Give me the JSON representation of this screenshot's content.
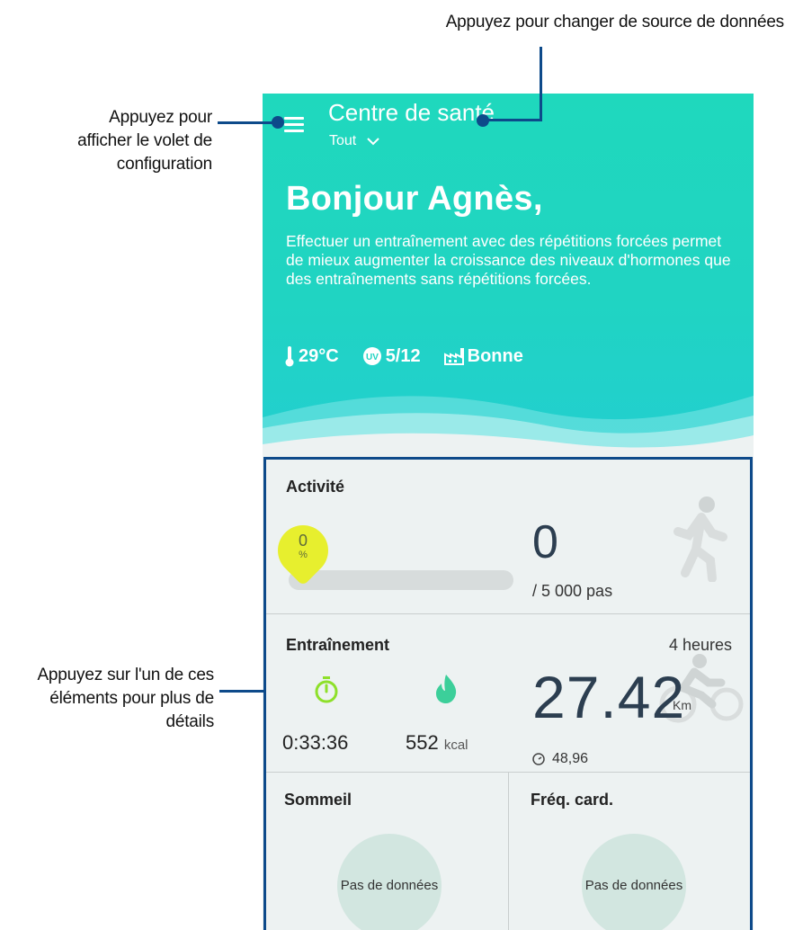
{
  "callouts": {
    "source": "Appuyez pour changer de source de données",
    "menu": [
      "Appuyez pour",
      "afficher le volet de",
      "configuration"
    ],
    "cards": [
      "Appuyez sur l'un de ces",
      "éléments pour plus de",
      "détails"
    ]
  },
  "header": {
    "app_title": "Centre de santé",
    "source": "Tout",
    "greeting": "Bonjour Agnès,",
    "tip": "Effectuer un entraînement avec des répétitions forcées permet de mieux augmenter la croissance des niveaux d'hormones que des entraînements sans répétitions forcées.",
    "weather": {
      "temperature": "29°C",
      "uv": "5/12",
      "air_quality": "Bonne"
    }
  },
  "activity": {
    "title": "Activité",
    "progress_value": "0",
    "progress_unit": "%",
    "progress_fraction": 0,
    "steps": "0",
    "goal": "/ 5 000 pas"
  },
  "training": {
    "title": "Entraînement",
    "duration": "4 heures",
    "time": "0:33:36",
    "calories": "552",
    "calories_unit": "kcal",
    "distance": "27.42",
    "distance_unit": "Km",
    "speed": "48,96"
  },
  "sleep": {
    "title": "Sommeil",
    "status": "Pas de données"
  },
  "heart_rate": {
    "title": "Fréq. card.",
    "status": "Pas de données"
  },
  "colors": {
    "header": "#20d4c2",
    "accent_blue": "#0d4a8a",
    "progress_bubble": "#e7ef2e",
    "timer_icon": "#8ee02a",
    "flame_icon": "#3ccf9a"
  },
  "icons": [
    "menu-icon",
    "chevron-down-icon",
    "thermometer-icon",
    "uv-icon",
    "factory-icon",
    "walking-person-icon",
    "stopwatch-icon",
    "flame-icon",
    "cyclist-icon",
    "speedometer-icon"
  ]
}
